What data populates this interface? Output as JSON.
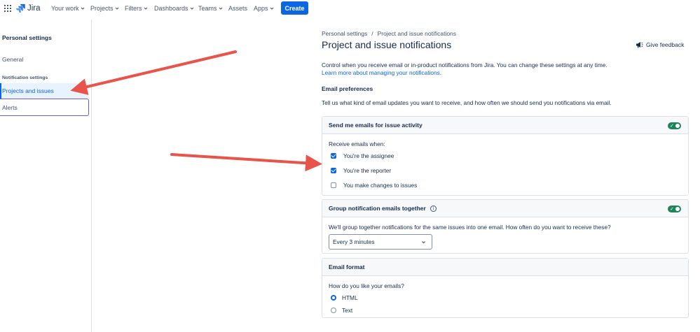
{
  "nav": {
    "logo_text": "Jira",
    "items": [
      {
        "label": "Your work"
      },
      {
        "label": "Projects"
      },
      {
        "label": "Filters"
      },
      {
        "label": "Dashboards"
      },
      {
        "label": "Teams"
      },
      {
        "label": "Assets"
      },
      {
        "label": "Apps"
      }
    ],
    "create_label": "Create"
  },
  "sidebar": {
    "title": "Personal settings",
    "general": "General",
    "section_label": "Notification settings",
    "items": [
      {
        "label": "Projects and issues",
        "active": true
      },
      {
        "label": "Alerts",
        "active": false
      }
    ]
  },
  "main": {
    "breadcrumb": [
      "Personal settings",
      "Project and issue notifications"
    ],
    "breadcrumb_sep": "/",
    "title": "Project and issue notifications",
    "feedback_label": "Give feedback",
    "intro": "Control when you receive email or in-product notifications from Jira. You can change these settings at any time.",
    "intro_link": "Learn more about managing your notifications.",
    "email_heading": "Email preferences",
    "email_desc": "Tell us what kind of email updates you want to receive, and how often we should send you notifications via email.",
    "issue_activity": {
      "title": "Send me emails for issue activity",
      "enabled": true,
      "receive_label": "Receive emails when:",
      "options": [
        {
          "label": "You're the assignee",
          "checked": true
        },
        {
          "label": "You're the reporter",
          "checked": true
        },
        {
          "label": "You make changes to issues",
          "checked": false
        }
      ]
    },
    "grouping": {
      "title": "Group notification emails together",
      "enabled": true,
      "desc": "We'll group together notifications for the same issues into one email. How often do you want to receive these?",
      "selected": "Every 3 minutes"
    },
    "format": {
      "title": "Email format",
      "question": "How do you like your emails?",
      "options": [
        {
          "label": "HTML",
          "selected": true
        },
        {
          "label": "Text",
          "selected": false
        }
      ]
    }
  },
  "colors": {
    "accent": "#0c66e4",
    "toggle_on": "#1f845a",
    "annotation_arrow": "#e8534a"
  }
}
